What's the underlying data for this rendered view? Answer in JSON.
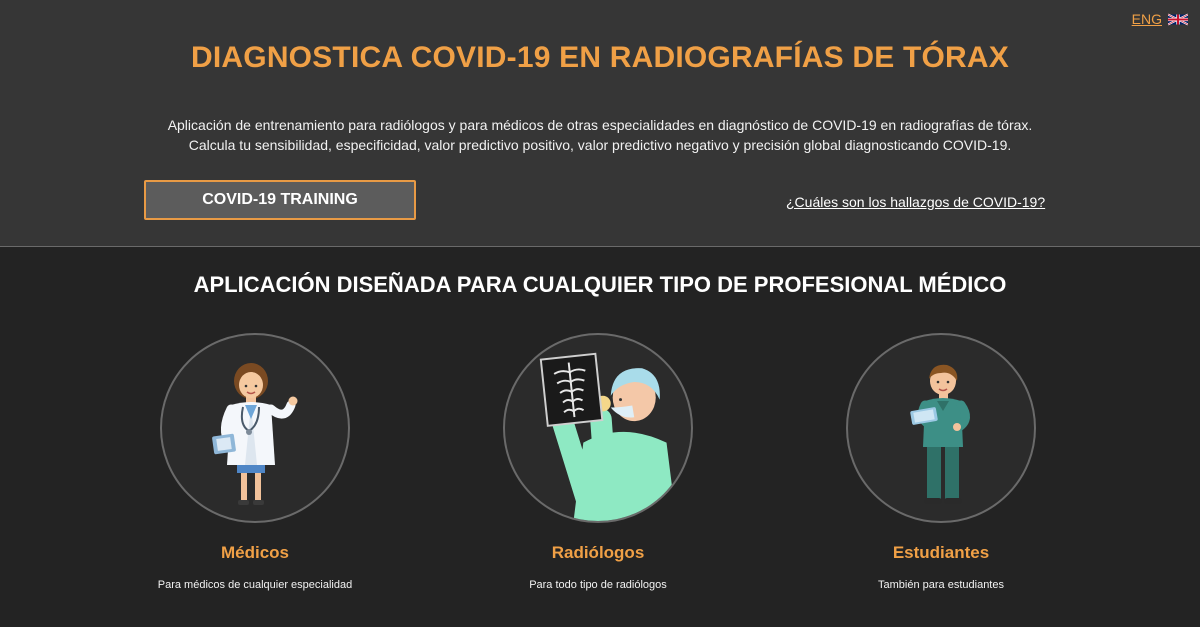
{
  "header": {
    "lang_label": "ENG",
    "flag_icon": "uk-flag-icon",
    "title": "DIAGNOSTICA COVID-19 EN RADIOGRAFÍAS DE TÓRAX",
    "description_line1": "Aplicación de entrenamiento para radiólogos y para médicos de otras especialidades en diagnóstico de COVID-19 en radiografías de tórax.",
    "description_line2": "Calcula tu sensibilidad, especificidad, valor predictivo positivo, valor predictivo negativo y precisión global diagnosticando COVID-19.",
    "training_button": "COVID-19 TRAINING",
    "findings_link": "¿Cuáles son los hallazgos de COVID-19?"
  },
  "audience": {
    "title": "APLICACIÓN DISEÑADA PARA CUALQUIER TIPO DE PROFESIONAL MÉDICO",
    "cards": [
      {
        "icon": "doctor-illustration",
        "title": "Médicos",
        "subtitle": "Para médicos de cualquier especialidad"
      },
      {
        "icon": "radiologist-illustration",
        "title": "Radiólogos",
        "subtitle": "Para todo tipo de radiólogos"
      },
      {
        "icon": "student-illustration",
        "title": "Estudiantes",
        "subtitle": "También para estudiantes"
      }
    ]
  },
  "colors": {
    "accent": "#f0a046",
    "hero_bg": "#363636",
    "page_bg": "#232323",
    "button_bg": "#5c5c5c"
  }
}
